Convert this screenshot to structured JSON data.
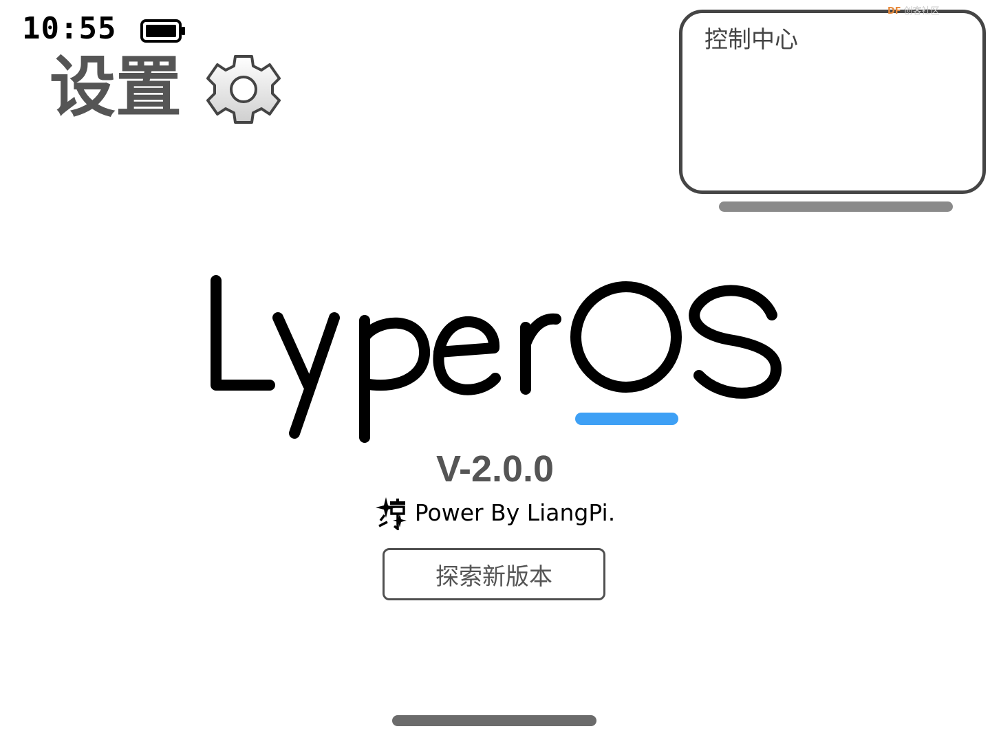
{
  "status_bar": {
    "time": "10:55",
    "battery_icon": "battery-full-icon"
  },
  "header": {
    "title": "设置",
    "icon": "gear-icon"
  },
  "control_center": {
    "title": "控制中心",
    "watermark_brand": "DF",
    "watermark_text": "创客社区"
  },
  "logo": {
    "text": "LyperOS",
    "underline_color": "#3ea0f5"
  },
  "about": {
    "version": "V-2.0.0",
    "power_icon": "liangpi-badge-icon",
    "power_text": "Power By LiangPi."
  },
  "actions": {
    "explore_label": "探索新版本"
  }
}
